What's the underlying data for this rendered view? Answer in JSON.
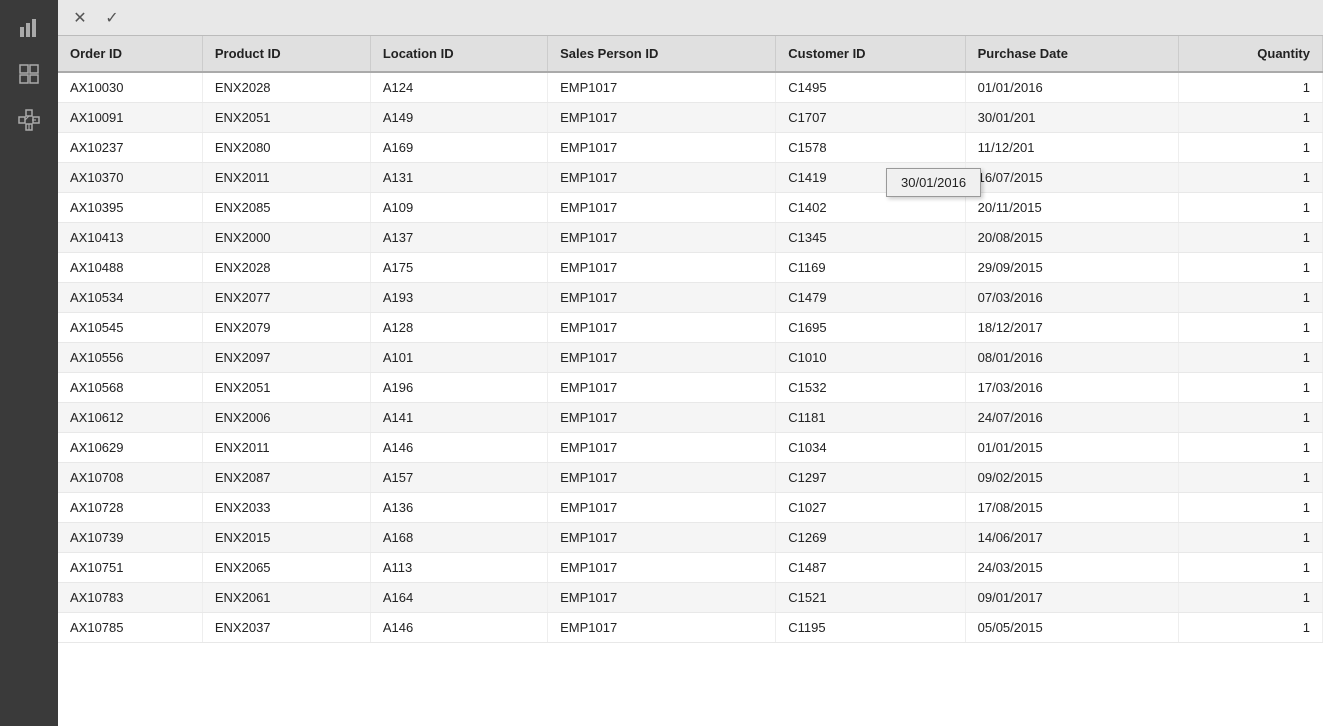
{
  "sidebar": {
    "icons": [
      {
        "name": "bar-chart-icon",
        "label": "Bar Chart"
      },
      {
        "name": "grid-icon",
        "label": "Grid/Table"
      },
      {
        "name": "diagram-icon",
        "label": "Diagram"
      }
    ]
  },
  "toolbar": {
    "cancel_label": "✕",
    "confirm_label": "✓"
  },
  "table": {
    "columns": [
      {
        "key": "order_id",
        "label": "Order ID"
      },
      {
        "key": "product_id",
        "label": "Product ID"
      },
      {
        "key": "location_id",
        "label": "Location ID"
      },
      {
        "key": "sales_person_id",
        "label": "Sales Person ID"
      },
      {
        "key": "customer_id",
        "label": "Customer ID"
      },
      {
        "key": "purchase_date",
        "label": "Purchase Date"
      },
      {
        "key": "quantity",
        "label": "Quantity"
      }
    ],
    "rows": [
      {
        "order_id": "AX10030",
        "product_id": "ENX2028",
        "location_id": "A124",
        "sales_person_id": "EMP1017",
        "customer_id": "C1495",
        "purchase_date": "01/01/2016",
        "quantity": "1"
      },
      {
        "order_id": "AX10091",
        "product_id": "ENX2051",
        "location_id": "A149",
        "sales_person_id": "EMP1017",
        "customer_id": "C1707",
        "purchase_date": "30/01/201",
        "quantity": "1"
      },
      {
        "order_id": "AX10237",
        "product_id": "ENX2080",
        "location_id": "A169",
        "sales_person_id": "EMP1017",
        "customer_id": "C1578",
        "purchase_date": "11/12/201",
        "quantity": "1"
      },
      {
        "order_id": "AX10370",
        "product_id": "ENX2011",
        "location_id": "A131",
        "sales_person_id": "EMP1017",
        "customer_id": "C1419",
        "purchase_date": "16/07/2015",
        "quantity": "1"
      },
      {
        "order_id": "AX10395",
        "product_id": "ENX2085",
        "location_id": "A109",
        "sales_person_id": "EMP1017",
        "customer_id": "C1402",
        "purchase_date": "20/11/2015",
        "quantity": "1"
      },
      {
        "order_id": "AX10413",
        "product_id": "ENX2000",
        "location_id": "A137",
        "sales_person_id": "EMP1017",
        "customer_id": "C1345",
        "purchase_date": "20/08/2015",
        "quantity": "1"
      },
      {
        "order_id": "AX10488",
        "product_id": "ENX2028",
        "location_id": "A175",
        "sales_person_id": "EMP1017",
        "customer_id": "C1169",
        "purchase_date": "29/09/2015",
        "quantity": "1"
      },
      {
        "order_id": "AX10534",
        "product_id": "ENX2077",
        "location_id": "A193",
        "sales_person_id": "EMP1017",
        "customer_id": "C1479",
        "purchase_date": "07/03/2016",
        "quantity": "1"
      },
      {
        "order_id": "AX10545",
        "product_id": "ENX2079",
        "location_id": "A128",
        "sales_person_id": "EMP1017",
        "customer_id": "C1695",
        "purchase_date": "18/12/2017",
        "quantity": "1"
      },
      {
        "order_id": "AX10556",
        "product_id": "ENX2097",
        "location_id": "A101",
        "sales_person_id": "EMP1017",
        "customer_id": "C1010",
        "purchase_date": "08/01/2016",
        "quantity": "1"
      },
      {
        "order_id": "AX10568",
        "product_id": "ENX2051",
        "location_id": "A196",
        "sales_person_id": "EMP1017",
        "customer_id": "C1532",
        "purchase_date": "17/03/2016",
        "quantity": "1"
      },
      {
        "order_id": "AX10612",
        "product_id": "ENX2006",
        "location_id": "A141",
        "sales_person_id": "EMP1017",
        "customer_id": "C1181",
        "purchase_date": "24/07/2016",
        "quantity": "1"
      },
      {
        "order_id": "AX10629",
        "product_id": "ENX2011",
        "location_id": "A146",
        "sales_person_id": "EMP1017",
        "customer_id": "C1034",
        "purchase_date": "01/01/2015",
        "quantity": "1"
      },
      {
        "order_id": "AX10708",
        "product_id": "ENX2087",
        "location_id": "A157",
        "sales_person_id": "EMP1017",
        "customer_id": "C1297",
        "purchase_date": "09/02/2015",
        "quantity": "1"
      },
      {
        "order_id": "AX10728",
        "product_id": "ENX2033",
        "location_id": "A136",
        "sales_person_id": "EMP1017",
        "customer_id": "C1027",
        "purchase_date": "17/08/2015",
        "quantity": "1"
      },
      {
        "order_id": "AX10739",
        "product_id": "ENX2015",
        "location_id": "A168",
        "sales_person_id": "EMP1017",
        "customer_id": "C1269",
        "purchase_date": "14/06/2017",
        "quantity": "1"
      },
      {
        "order_id": "AX10751",
        "product_id": "ENX2065",
        "location_id": "A113",
        "sales_person_id": "EMP1017",
        "customer_id": "C1487",
        "purchase_date": "24/03/2015",
        "quantity": "1"
      },
      {
        "order_id": "AX10783",
        "product_id": "ENX2061",
        "location_id": "A164",
        "sales_person_id": "EMP1017",
        "customer_id": "C1521",
        "purchase_date": "09/01/2017",
        "quantity": "1"
      },
      {
        "order_id": "AX10785",
        "product_id": "ENX2037",
        "location_id": "A146",
        "sales_person_id": "EMP1017",
        "customer_id": "C1195",
        "purchase_date": "05/05/2015",
        "quantity": "1"
      }
    ]
  },
  "tooltip": {
    "text": "30/01/2016",
    "visible": true
  }
}
